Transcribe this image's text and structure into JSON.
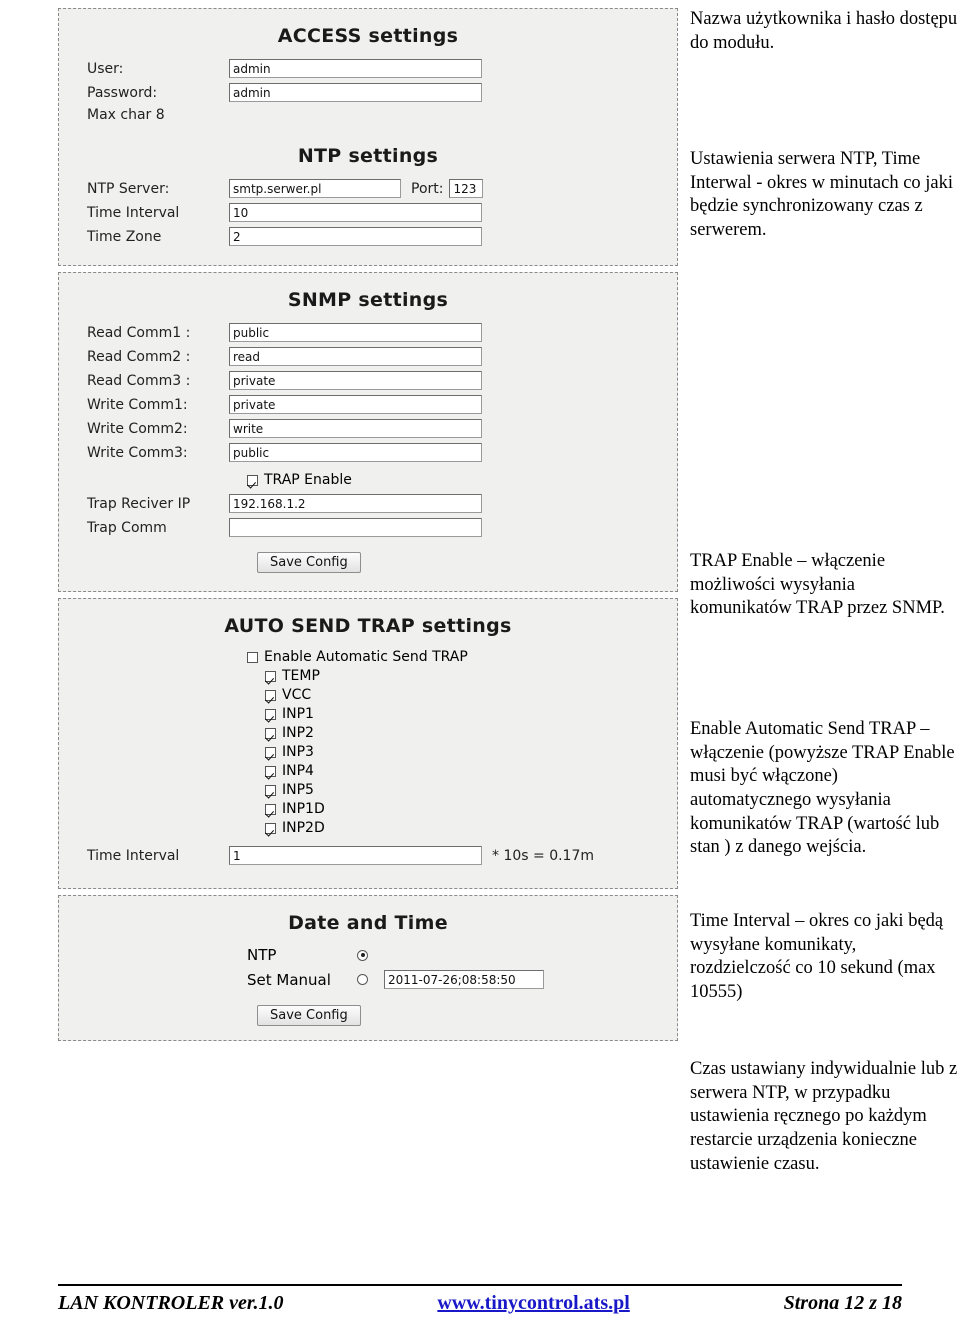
{
  "access": {
    "title": "ACCESS settings",
    "user_label": "User:",
    "user_value": "admin",
    "password_label": "Password:",
    "password_value": "admin",
    "maxchar_note": "Max char 8"
  },
  "ntp": {
    "title": "NTP settings",
    "server_label": "NTP Server:",
    "server_value": "smtp.serwer.pl",
    "port_label": "Port:",
    "port_value": "123",
    "interval_label": "Time Interval",
    "interval_value": "10",
    "zone_label": "Time Zone",
    "zone_value": "2"
  },
  "snmp": {
    "title": "SNMP settings",
    "rows": [
      {
        "label": "Read Comm1 :",
        "value": "public"
      },
      {
        "label": "Read Comm2 :",
        "value": "read"
      },
      {
        "label": "Read Comm3 :",
        "value": "private"
      },
      {
        "label": "Write Comm1:",
        "value": "private"
      },
      {
        "label": "Write Comm2:",
        "value": "write"
      },
      {
        "label": "Write Comm3:",
        "value": "public"
      }
    ],
    "trap_enable_label": "TRAP Enable",
    "trap_enable_checked": true,
    "trap_ip_label": "Trap Reciver IP",
    "trap_ip_value": "192.168.1.2",
    "trap_comm_label": "Trap Comm",
    "trap_comm_value": "",
    "save_label": "Save Config"
  },
  "autosend": {
    "title": "AUTO SEND TRAP settings",
    "enable_label": "Enable Automatic Send TRAP",
    "enable_checked": false,
    "items": [
      {
        "label": "TEMP",
        "checked": true
      },
      {
        "label": "VCC",
        "checked": true
      },
      {
        "label": "INP1",
        "checked": true
      },
      {
        "label": "INP2",
        "checked": true
      },
      {
        "label": "INP3",
        "checked": true
      },
      {
        "label": "INP4",
        "checked": true
      },
      {
        "label": "INP5",
        "checked": true
      },
      {
        "label": "INP1D",
        "checked": true
      },
      {
        "label": "INP2D",
        "checked": true
      }
    ],
    "interval_label": "Time Interval",
    "interval_value": "1",
    "interval_note": "* 10s = 0.17m"
  },
  "datetime": {
    "title": "Date and Time",
    "ntp_label": "NTP",
    "ntp_selected": true,
    "manual_label": "Set Manual",
    "manual_selected": false,
    "manual_value": "2011-07-26;08:58:50",
    "save_label": "Save Config"
  },
  "notes": {
    "n1": "Nazwa użytkownika  i hasło dostępu do modułu.",
    "n2": "Ustawienia serwera NTP, Time Interwal - okres w minutach co jaki będzie synchronizowany czas z serwerem.",
    "n3": "TRAP Enable – włączenie możliwości wysyłania komunikatów TRAP przez SNMP.",
    "n4": "Enable Automatic Send TRAP – włączenie (powyższe TRAP Enable musi być włączone) automatycznego wysyłania komunikatów TRAP  (wartość lub stan ) z danego wejścia.",
    "n5": "Time Interval – okres co jaki będą wysyłane komunikaty, rozdzielczość co 10 sekund (max 10555)",
    "n6": "Czas ustawiany indywidualnie lub z serwera NTP, w przypadku ustawienia ręcznego po każdym restarcie urządzenia konieczne ustawienie czasu."
  },
  "footer": {
    "left": "LAN KONTROLER  ver.1.0",
    "middle": "www.tinycontrol.ats.pl",
    "right": "Strona 12 z 18"
  }
}
